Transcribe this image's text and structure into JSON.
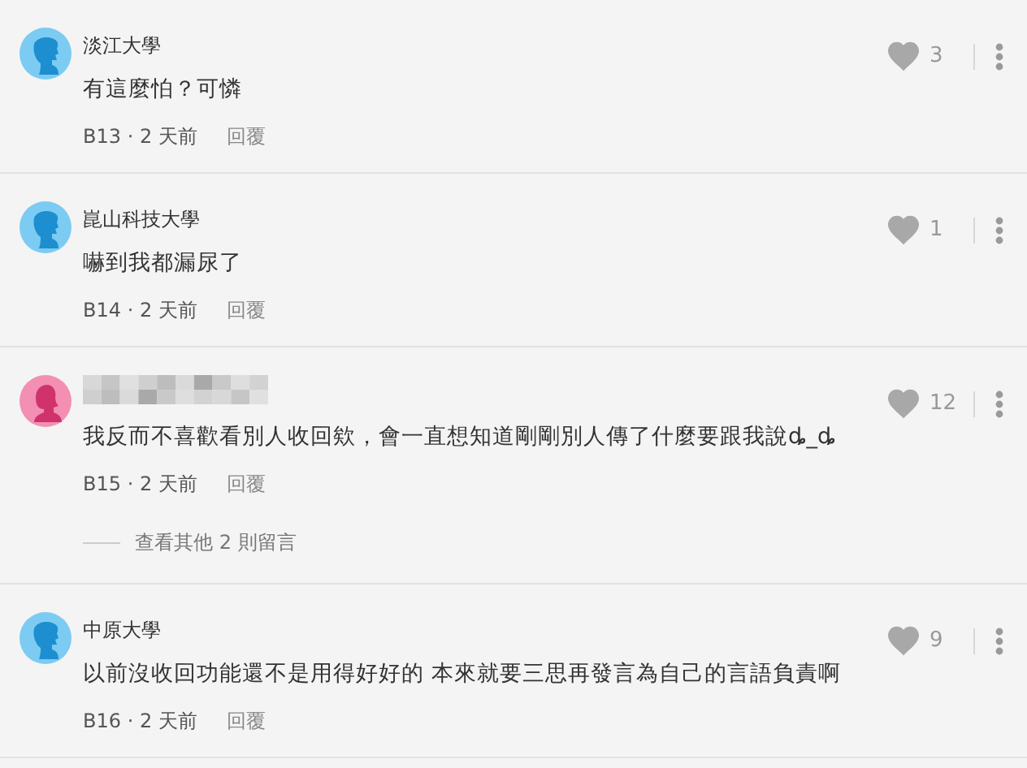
{
  "comments": [
    {
      "kind": "male",
      "color": "#7ccbf2",
      "name": "淡江大學",
      "name_blurred": false,
      "text": "有這麼怕？可憐",
      "meta": "B13 · 2 天前",
      "reply": "回覆",
      "likes": "3"
    },
    {
      "kind": "male",
      "color": "#7ccbf2",
      "name": "崑山科技大學",
      "name_blurred": false,
      "text": "嚇到我都漏尿了",
      "meta": "B14 · 2 天前",
      "reply": "回覆",
      "likes": "1"
    },
    {
      "kind": "female",
      "color": "#f38fb3",
      "name_blurred": true,
      "text": "我反而不喜歡看別人收回欸，會一直想知道剛剛別人傳了什麼要跟我說ȡ_ȡ",
      "meta": "B15 · 2 天前",
      "reply": "回覆",
      "likes": "12",
      "more": "查看其他 2 則留言"
    },
    {
      "kind": "male",
      "color": "#7ccbf2",
      "name": "中原大學",
      "name_blurred": false,
      "text": "以前沒收回功能還不是用得好好的 本來就要三思再發言為自己的言語負責啊",
      "meta": "B16 · 2 天前",
      "reply": "回覆",
      "likes": "9"
    }
  ]
}
